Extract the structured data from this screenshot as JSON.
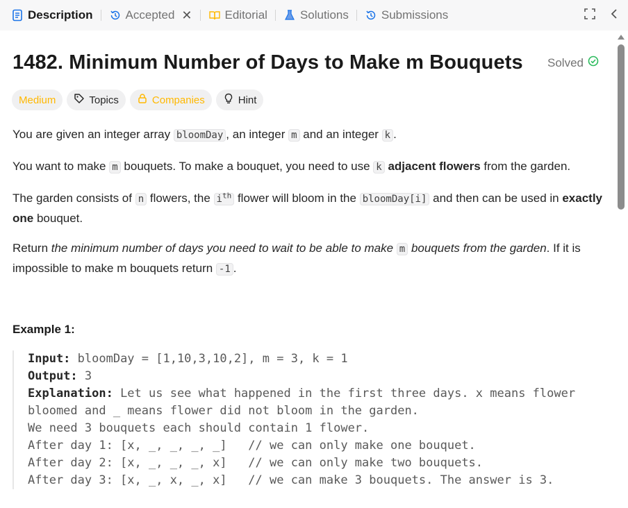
{
  "tabs": [
    {
      "label": "Description",
      "icon": "description-icon",
      "active": true
    },
    {
      "label": "Accepted",
      "icon": "history-icon",
      "closable": true
    },
    {
      "label": "Editorial",
      "icon": "book-icon"
    },
    {
      "label": "Solutions",
      "icon": "flask-icon"
    },
    {
      "label": "Submissions",
      "icon": "history-icon"
    }
  ],
  "problem": {
    "title": "1482. Minimum Number of Days to Make m Bouquets",
    "status": "Solved",
    "difficulty": "Medium",
    "chips": {
      "topics": "Topics",
      "companies": "Companies",
      "hint": "Hint"
    }
  },
  "description": {
    "p1": {
      "a": "You are given an integer array ",
      "c1": "bloomDay",
      "b": ", an integer ",
      "c2": "m",
      "c": " and an integer ",
      "c3": "k",
      "d": "."
    },
    "p2": {
      "a": "You want to make ",
      "c1": "m",
      "b": " bouquets. To make a bouquet, you need to use ",
      "c2": "k",
      "strong": "adjacent flowers",
      "c": " from the garden."
    },
    "p3": {
      "a": "The garden consists of ",
      "c1": "n",
      "b": " flowers, the ",
      "c2": "i",
      "sup": "th",
      "c": " flower will bloom in the ",
      "c3": "bloomDay[i]",
      "d": " and then can be used in ",
      "strong": "exactly one",
      "e": " bouquet."
    },
    "p4": {
      "a": "Return ",
      "em1": "the minimum number of days you need to wait to be able to make ",
      "c1": "m",
      "em2": " bouquets from the garden",
      "b": ". If it is impossible to make m bouquets return ",
      "c2": "-1",
      "c": "."
    }
  },
  "example": {
    "title": "Example 1:",
    "input_label": "Input:",
    "input": " bloomDay = [1,10,3,10,2], m = 3, k = 1",
    "output_label": "Output:",
    "output": " 3",
    "explanation_label": "Explanation:",
    "explanation_lines": [
      " Let us see what happened in the first three days. x means flower",
      "bloomed and _ means flower did not bloom in the garden.",
      "We need 3 bouquets each should contain 1 flower.",
      "After day 1: [x, _, _, _, _]   // we can only make one bouquet.",
      "After day 2: [x, _, _, _, x]   // we can only make two bouquets.",
      "After day 3: [x, _, x, _, x]   // we can make 3 bouquets. The answer is 3."
    ]
  },
  "colors": {
    "accent_blue": "#1a73e8",
    "solved_green": "#2cbb5d",
    "medium_yellow": "#ffb800"
  }
}
